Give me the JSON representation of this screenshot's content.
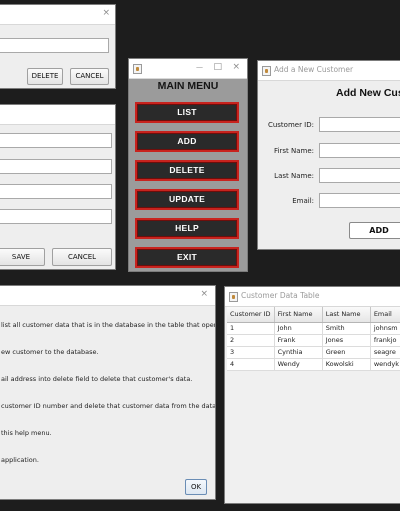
{
  "delete_window": {
    "close_glyph": "×",
    "delete_label": "DELETE",
    "cancel_label": "CANCEL"
  },
  "update_window": {
    "save_label": "SAVE",
    "cancel_label": "CANCEL"
  },
  "main_menu": {
    "minimize_glyph": "—",
    "maximize_glyph": "□",
    "close_glyph": "×",
    "heading": "MAIN MENU",
    "buttons": [
      "LIST",
      "ADD",
      "DELETE",
      "UPDATE",
      "HELP",
      "EXIT"
    ],
    "button_color": "#2a2a2a",
    "border_color": "#c8231e"
  },
  "add_window": {
    "title": "Add a New Customer",
    "heading": "Add New Custo",
    "labels": {
      "customer_id": "Customer ID:",
      "first_name": "First Name:",
      "last_name": "Last Name:",
      "email": "Email:"
    },
    "add_label": "ADD"
  },
  "help_window": {
    "close_glyph": "×",
    "lines": [
      "list all customer data that is in the database in the table that opens.",
      "ew customer to the database.",
      "ail address into delete field to delete that customer's data.",
      "customer ID number and delete that customer data from the database.",
      "this help menu.",
      "application."
    ],
    "ok_label": "OK"
  },
  "table_window": {
    "title": "Customer Data Table",
    "columns": [
      "Customer ID",
      "First Name",
      "Last Name",
      "Email"
    ],
    "rows": [
      [
        "1",
        "John",
        "Smith",
        "johnsm"
      ],
      [
        "2",
        "Frank",
        "Jones",
        "frankjo"
      ],
      [
        "3",
        "Cynthia",
        "Green",
        "seagre"
      ],
      [
        "4",
        "Wendy",
        "Kowolski",
        "wendyk"
      ]
    ]
  }
}
